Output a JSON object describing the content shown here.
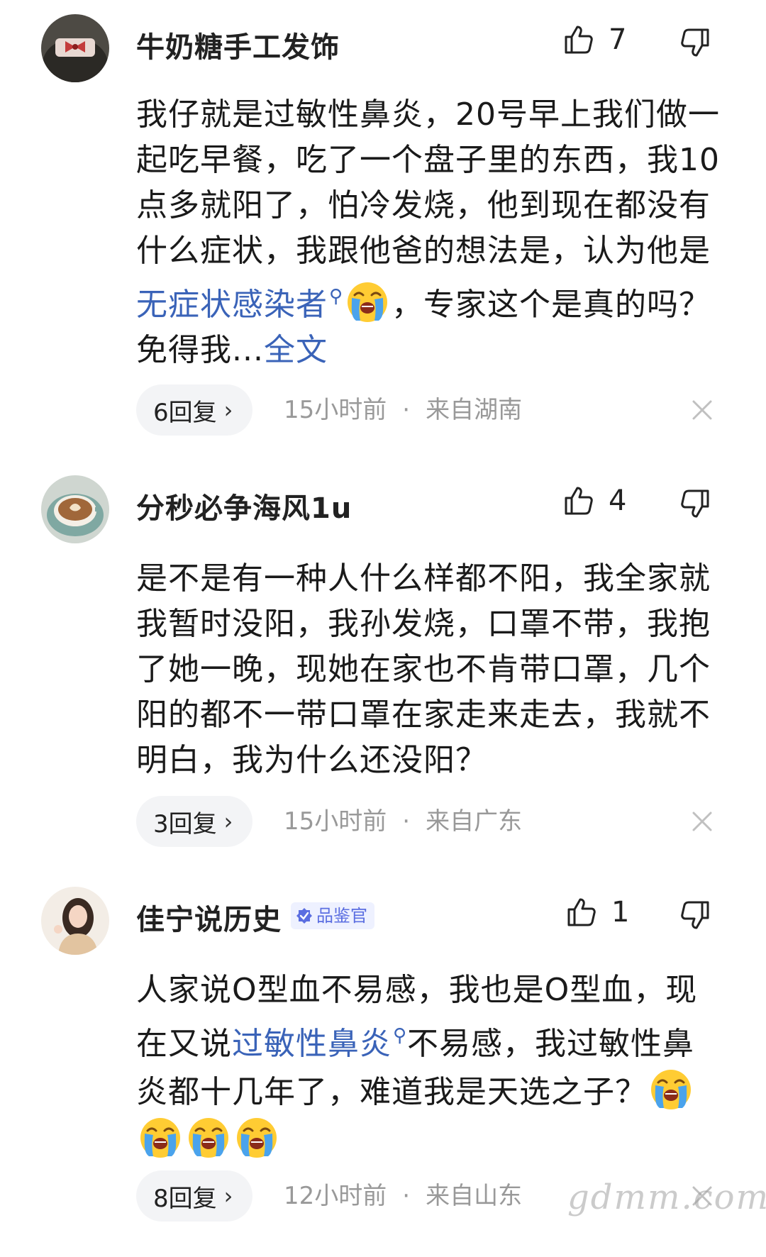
{
  "comments": [
    {
      "username": "牛奶糖手工发饰",
      "likes": "7",
      "body": {
        "p1": "我仔就是过敏性鼻炎，20号早上我们做一起吃早餐，吃了一个盘子里的东西，我10点多就阳了，怕冷发烧，他到现在都没有什么症状，我跟他爸的想法是，认为他是",
        "link": "无症状感染者",
        "p2": "，专家这个是真的吗？免得我...",
        "full": "全文"
      },
      "reply_label": "6回复",
      "time": "15小时前",
      "location": "来自湖南"
    },
    {
      "username": "分秒必争海风1u",
      "likes": "4",
      "body": {
        "p1": "是不是有一种人什么样都不阳，我全家就我暂时没阳，我孙发烧，口罩不带，我抱了她一晚，现她在家也不肯带口罩，几个阳的都不一带口罩在家走来走去，我就不明白，我为什么还没阳？"
      },
      "reply_label": "3回复",
      "time": "15小时前",
      "location": "来自广东"
    },
    {
      "username": "佳宁说历史",
      "badge": "品鉴官",
      "likes": "1",
      "body": {
        "p1": "人家说O型血不易感，我也是O型血，现在又说",
        "link": "过敏性鼻炎",
        "p2": "不易感，我过敏性鼻炎都十几年了，难道我是天选之子？"
      },
      "reply_label": "8回复",
      "time": "12小时前",
      "location": "来自山东"
    }
  ],
  "dot": "·",
  "chevron": "›",
  "search_glyph": "⚲",
  "watermark": "gdmm.com",
  "colors": {
    "link": "#3a63b8",
    "meta": "#999999",
    "pill_bg": "#f3f4f6",
    "badge_bg": "#eef1ff",
    "badge_text": "#5b6ee1"
  },
  "icons": [
    "thumbs-up-icon",
    "thumbs-down-icon",
    "close-icon",
    "chevron-right-icon",
    "search-icon",
    "crying-emoji",
    "verified-badge-icon"
  ]
}
